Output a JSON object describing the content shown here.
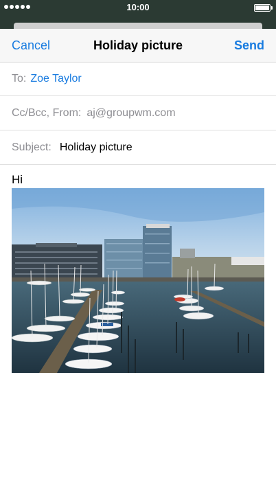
{
  "status_bar": {
    "time": "10:00",
    "signal_dots": 5
  },
  "nav": {
    "cancel_label": "Cancel",
    "title": "Holiday picture",
    "send_label": "Send"
  },
  "fields": {
    "to_label": "To:",
    "to_value": "Zoe Taylor",
    "ccbcc_label": "Cc/Bcc, From:",
    "from_value": "aj@groupwm.com",
    "subject_label": "Subject:",
    "subject_value": "Holiday picture"
  },
  "body": {
    "text": "Hi"
  },
  "colors": {
    "accent": "#1a7ce0",
    "status_bar": "#2b3a33",
    "label_gray": "#8e8e93"
  },
  "icons": [
    "signal-dots-icon",
    "battery-icon"
  ]
}
